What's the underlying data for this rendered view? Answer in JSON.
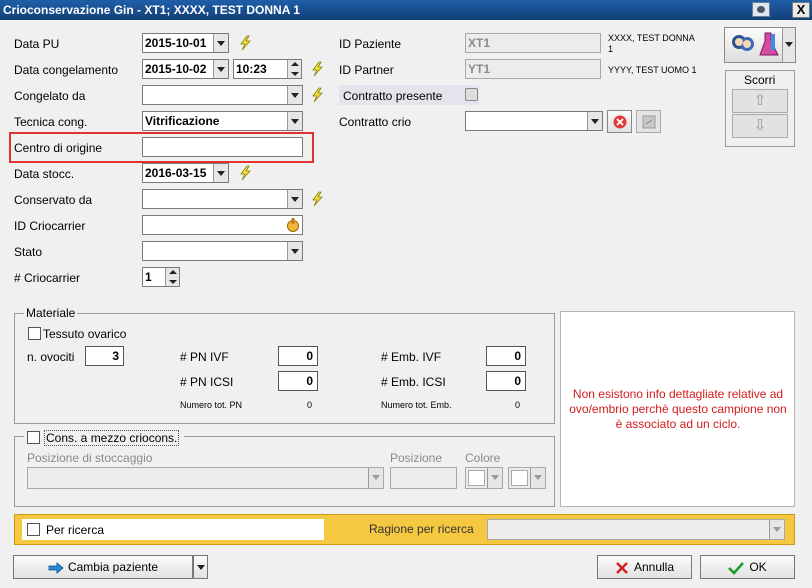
{
  "window": {
    "title": "Crioconservazione Gin  - XT1; XXXX, TEST DONNA 1",
    "close_label": "X"
  },
  "form": {
    "data_pu": {
      "label": "Data PU",
      "value": "2015-10-01"
    },
    "data_congelamento": {
      "label": "Data congelamento",
      "date": "2015-10-02",
      "time": "10:23"
    },
    "congelato_da": {
      "label": "Congelato da",
      "value": ""
    },
    "tecnica_cong": {
      "label": "Tecnica cong.",
      "value": "Vitrificazione"
    },
    "centro_origine": {
      "label": "Centro di origine",
      "value": ""
    },
    "data_stocc": {
      "label": "Data stocc.",
      "value": "2016-03-15"
    },
    "conservato_da": {
      "label": "Conservato da",
      "value": ""
    },
    "id_criocarrier": {
      "label": "ID Criocarrier",
      "value": ""
    },
    "stato": {
      "label": "Stato",
      "value": ""
    },
    "num_criocarrier": {
      "label": "# Criocarrier",
      "value": "1"
    }
  },
  "patient": {
    "id_paziente": {
      "label": "ID Paziente",
      "value": "XT1",
      "name_line1": "XXXX, TEST DONNA",
      "name_line2": "1"
    },
    "id_partner": {
      "label": "ID Partner",
      "value": "YT1",
      "name": "YYYY, TEST UOMO 1"
    },
    "contratto_presente": {
      "label": "Contratto presente"
    },
    "contratto_crio": {
      "label": "Contratto crio",
      "value": ""
    }
  },
  "scorri": {
    "label": "Scorri"
  },
  "materiale": {
    "legend": "Materiale",
    "tessuto_ovarico": "Tessuto ovarico",
    "n_ovociti": {
      "label": "n. ovociti",
      "value": "3"
    },
    "pn_ivf": {
      "label": "# PN IVF",
      "value": "0"
    },
    "pn_icsi": {
      "label": "# PN ICSI",
      "value": "0"
    },
    "numero_tot_pn": {
      "label": "Numero tot. PN",
      "value": "0"
    },
    "emb_ivf": {
      "label": "# Emb. IVF",
      "value": "0"
    },
    "emb_icsi": {
      "label": "# Emb. ICSI",
      "value": "0"
    },
    "numero_tot_emb": {
      "label": "Numero tot. Emb.",
      "value": "0"
    }
  },
  "info_message": "Non esistono info dettagliate relative ad ovo/embrio perchè questo campione non è associato ad un ciclo.",
  "cons_criocons": {
    "label": "Cons. a mezzo criocons.",
    "posizione_stoccaggio": "Posizione di stoccaggio",
    "posizione": "Posizione",
    "colore": "Colore"
  },
  "ricerca": {
    "per_ricerca": "Per ricerca",
    "ragione_label": "Ragione per ricerca",
    "ragione_value": ""
  },
  "buttons": {
    "cambia_paziente": "Cambia paziente",
    "annulla": "Annulla",
    "ok": "OK"
  },
  "colors": {
    "title_bar": "#1f5fa8",
    "highlight": "#e23131",
    "yellow_bar": "#f5c842",
    "info_text": "#d21c1c"
  }
}
